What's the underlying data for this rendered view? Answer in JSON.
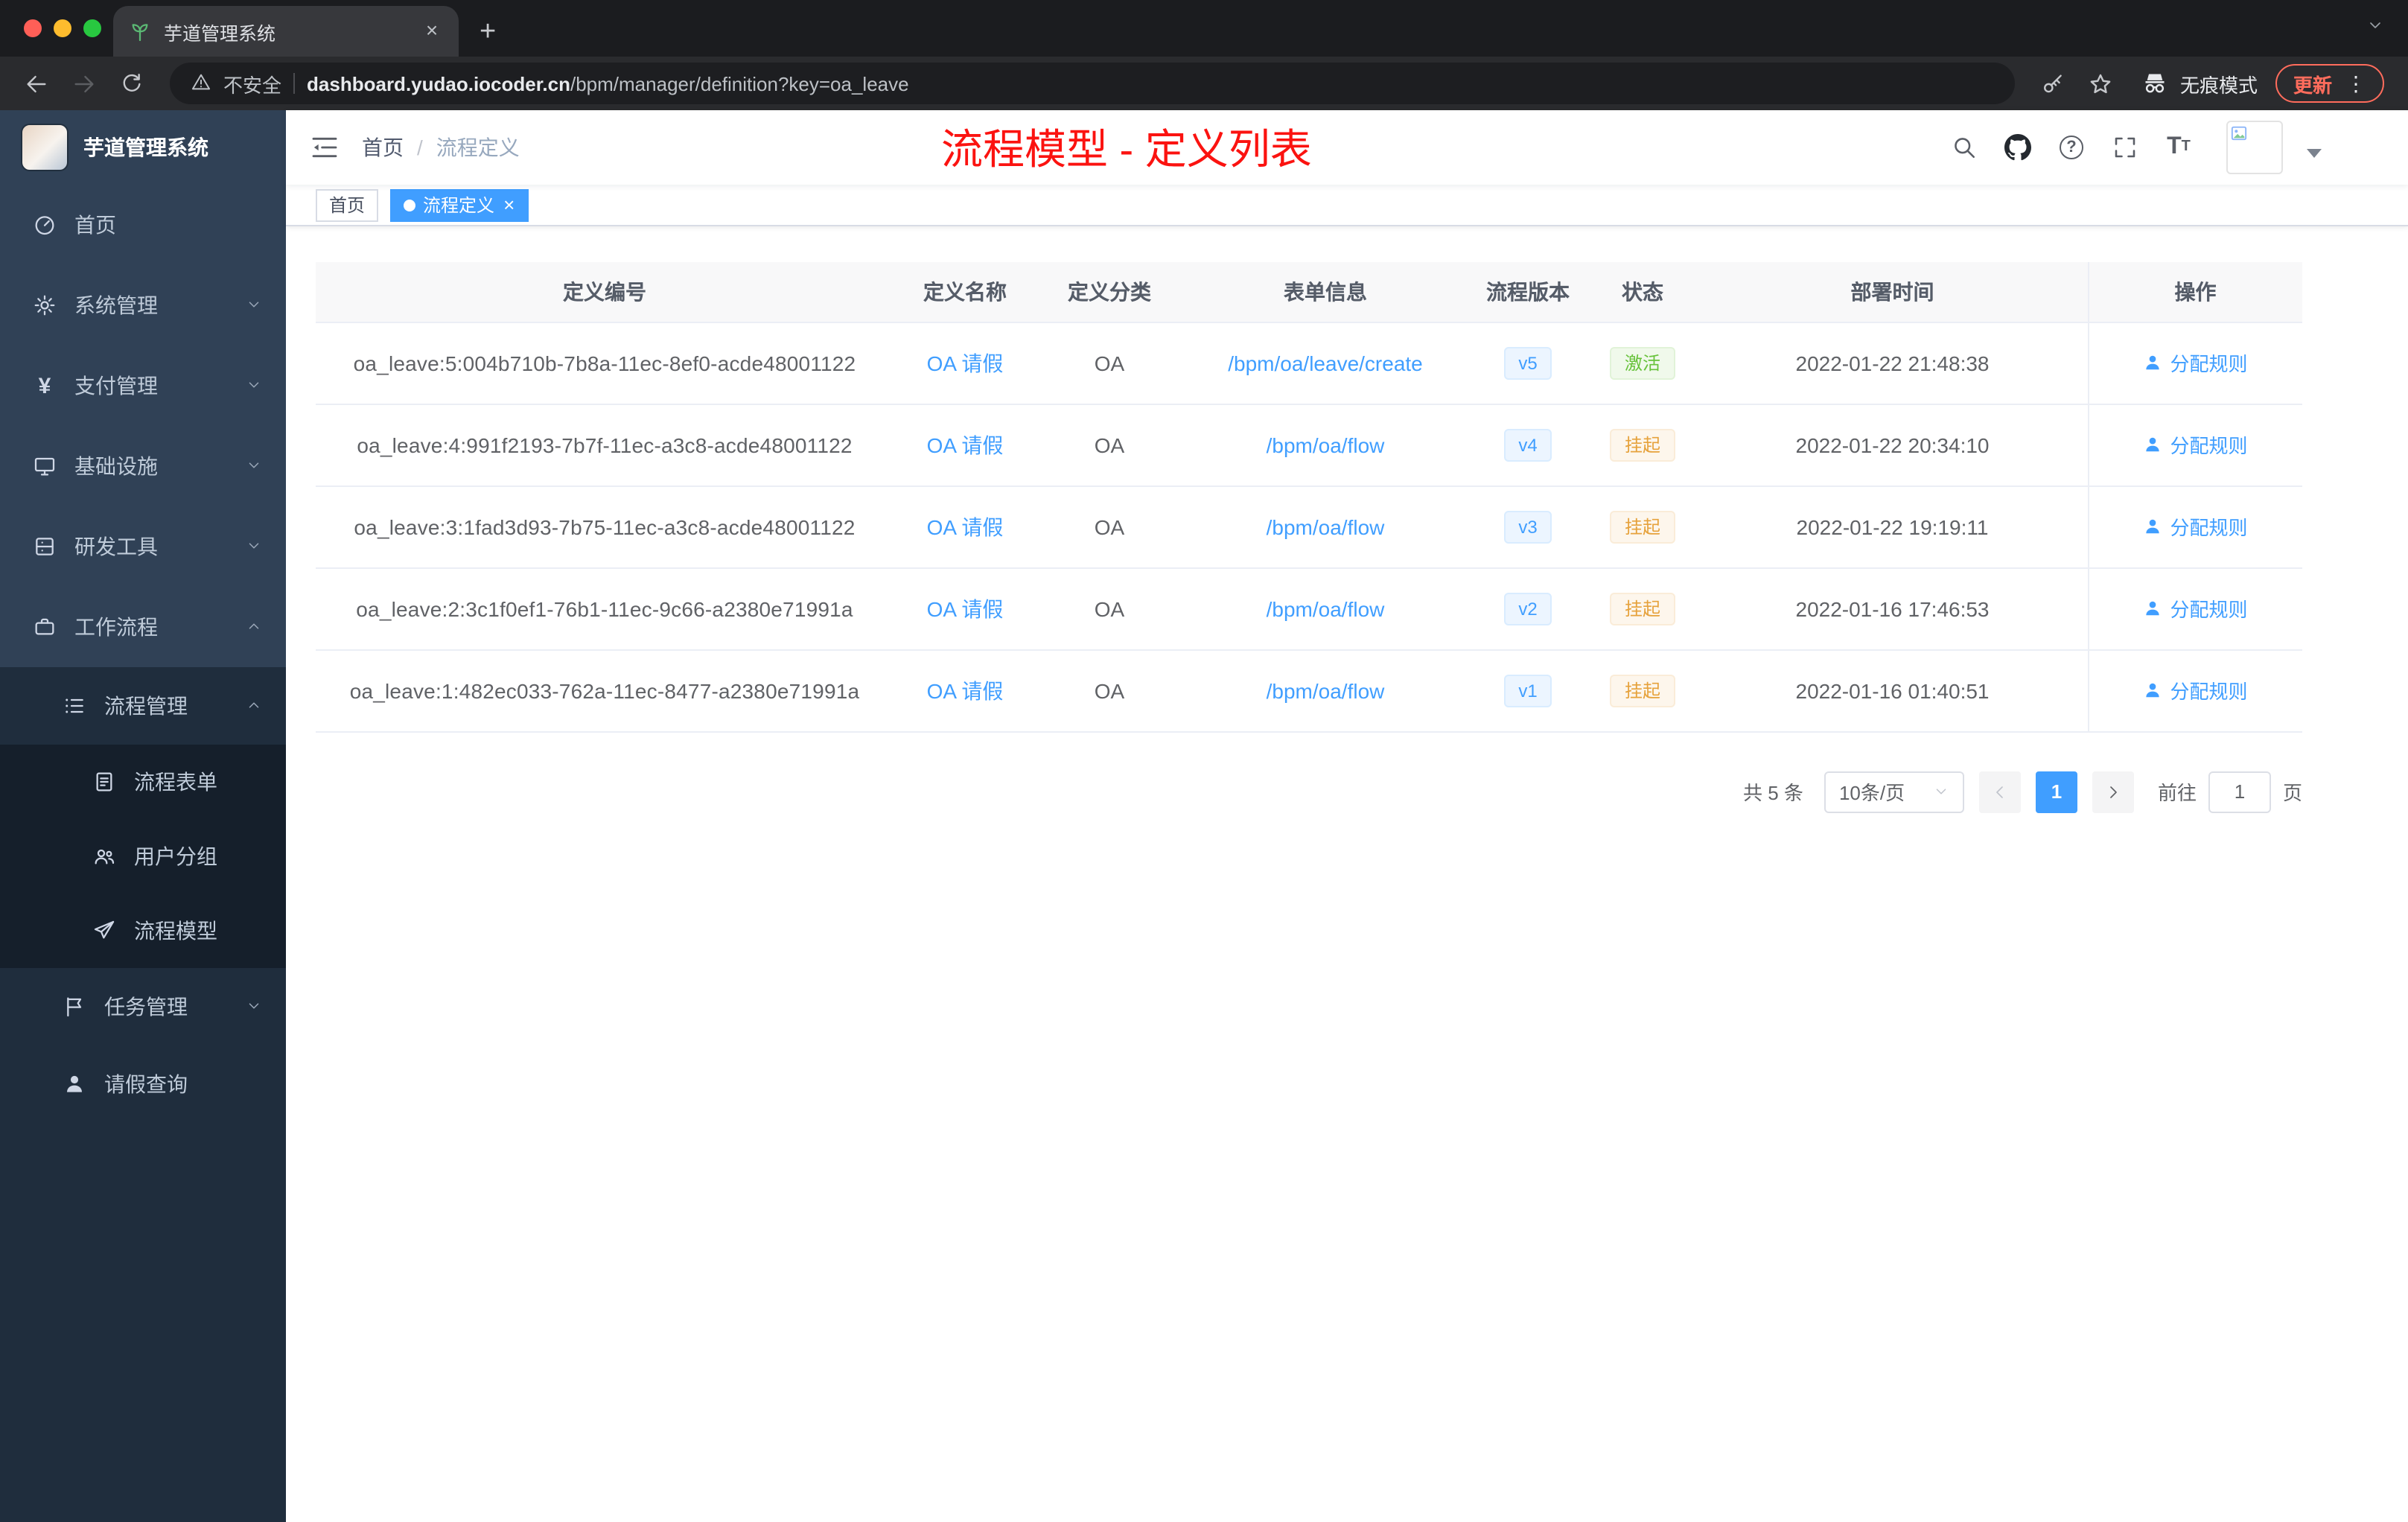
{
  "colors": {
    "accent": "#409eff",
    "annotation_red": "#fb1310",
    "status_active_green": "#67c23a",
    "status_suspended_orange": "#e6a23c",
    "update_chip_orange": "#ff6c5c",
    "sidebar_bg": "#304156",
    "sidebar_sub_bg": "#1f2d3d"
  },
  "icons": {
    "close": "×",
    "plus": "+",
    "more_vertical": "⋮",
    "question_mark": "?",
    "font_big": "T",
    "font_small": "T",
    "yen": "¥"
  },
  "browser": {
    "tab_title": "芋道管理系统",
    "security_label": "不安全",
    "url_domain": "dashboard.yudao.iocoder.cn",
    "url_path": "/bpm/manager/definition?key=oa_leave",
    "incognito_label": "无痕模式",
    "update_label": "更新"
  },
  "sidebar": {
    "logo_title": "芋道管理系统",
    "items": [
      {
        "label": "首页"
      },
      {
        "label": "系统管理"
      },
      {
        "label": "支付管理"
      },
      {
        "label": "基础设施"
      },
      {
        "label": "研发工具"
      },
      {
        "label": "工作流程"
      },
      {
        "label": "流程管理"
      },
      {
        "label": "流程表单"
      },
      {
        "label": "用户分组"
      },
      {
        "label": "流程模型"
      },
      {
        "label": "任务管理"
      },
      {
        "label": "请假查询"
      }
    ]
  },
  "header": {
    "breadcrumb": [
      "首页",
      "流程定义"
    ],
    "breadcrumb_separator": "/",
    "annotation": "流程模型 - 定义列表"
  },
  "tags": {
    "items": [
      {
        "label": "首页",
        "active": false
      },
      {
        "label": "流程定义",
        "active": true
      }
    ]
  },
  "table": {
    "columns": [
      "定义编号",
      "定义名称",
      "定义分类",
      "表单信息",
      "流程版本",
      "状态",
      "部署时间",
      "操作"
    ],
    "rows": [
      {
        "id": "oa_leave:5:004b710b-7b8a-11ec-8ef0-acde48001122",
        "name": "OA 请假",
        "category": "OA",
        "form": "/bpm/oa/leave/create",
        "version": "v5",
        "status": "激活",
        "status_type": "active",
        "deployed_at": "2022-01-22 21:48:38",
        "action": "分配规则"
      },
      {
        "id": "oa_leave:4:991f2193-7b7f-11ec-a3c8-acde48001122",
        "name": "OA 请假",
        "category": "OA",
        "form": "/bpm/oa/flow",
        "version": "v4",
        "status": "挂起",
        "status_type": "suspended",
        "deployed_at": "2022-01-22 20:34:10",
        "action": "分配规则"
      },
      {
        "id": "oa_leave:3:1fad3d93-7b75-11ec-a3c8-acde48001122",
        "name": "OA 请假",
        "category": "OA",
        "form": "/bpm/oa/flow",
        "version": "v3",
        "status": "挂起",
        "status_type": "suspended",
        "deployed_at": "2022-01-22 19:19:11",
        "action": "分配规则"
      },
      {
        "id": "oa_leave:2:3c1f0ef1-76b1-11ec-9c66-a2380e71991a",
        "name": "OA 请假",
        "category": "OA",
        "form": "/bpm/oa/flow",
        "version": "v2",
        "status": "挂起",
        "status_type": "suspended",
        "deployed_at": "2022-01-16 17:46:53",
        "action": "分配规则"
      },
      {
        "id": "oa_leave:1:482ec033-762a-11ec-8477-a2380e71991a",
        "name": "OA 请假",
        "category": "OA",
        "form": "/bpm/oa/flow",
        "version": "v1",
        "status": "挂起",
        "status_type": "suspended",
        "deployed_at": "2022-01-16 01:40:51",
        "action": "分配规则"
      }
    ]
  },
  "pagination": {
    "total": "共 5 条",
    "page_size": "10条/页",
    "current_page": "1",
    "goto_label": "前往",
    "goto_value": "1",
    "unit_label": "页"
  }
}
